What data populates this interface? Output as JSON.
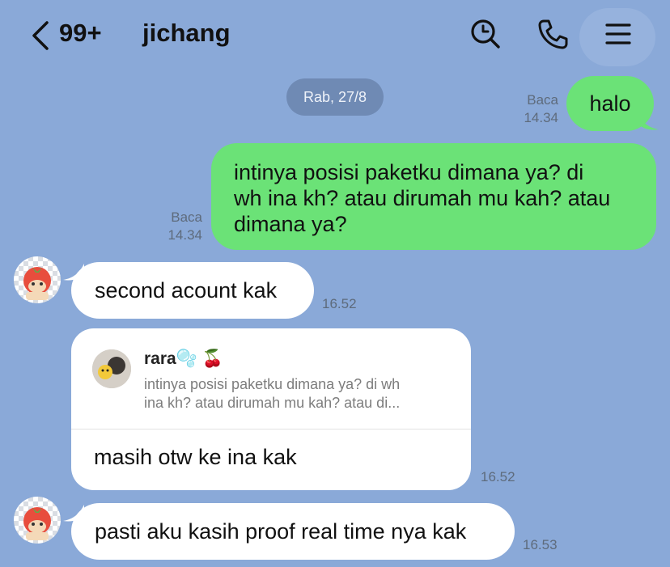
{
  "header": {
    "unread_count": "99+",
    "contact_name": "jichang",
    "icons": [
      "chevron-left-icon",
      "search-icon",
      "phone-icon",
      "menu-icon"
    ]
  },
  "date_separator": "Rab, 27/8",
  "messages": [
    {
      "side": "sent",
      "text": "halo",
      "read_label": "Baca",
      "time": "14.34"
    },
    {
      "side": "sent",
      "text": "intinya posisi paketku dimana ya? di wh ina kh? atau dirumah mu kah? atau dimana ya?",
      "lines": [
        "intinya posisi paketku dimana ya? di",
        "wh ina kh? atau dirumah mu kah? atau",
        "dimana ya?"
      ],
      "read_label": "Baca",
      "time": "14.34"
    },
    {
      "side": "received",
      "text": "second acount kak",
      "time": "16.52"
    },
    {
      "side": "received",
      "type": "reply",
      "quoted_name": "rara🫧 🍒",
      "quoted_lines": [
        "intinya posisi paketku dimana ya? di wh",
        "ina kh? atau dirumah mu kah? atau di..."
      ],
      "text": "masih otw ke ina kak",
      "time": "16.52"
    },
    {
      "side": "received",
      "text": "pasti aku kasih proof real time nya kak",
      "time": "16.53"
    }
  ],
  "colors": {
    "background": "#8aa9d8",
    "sent_bubble": "#6be277",
    "received_bubble": "#ffffff",
    "date_pill": "#6f8ab4"
  }
}
